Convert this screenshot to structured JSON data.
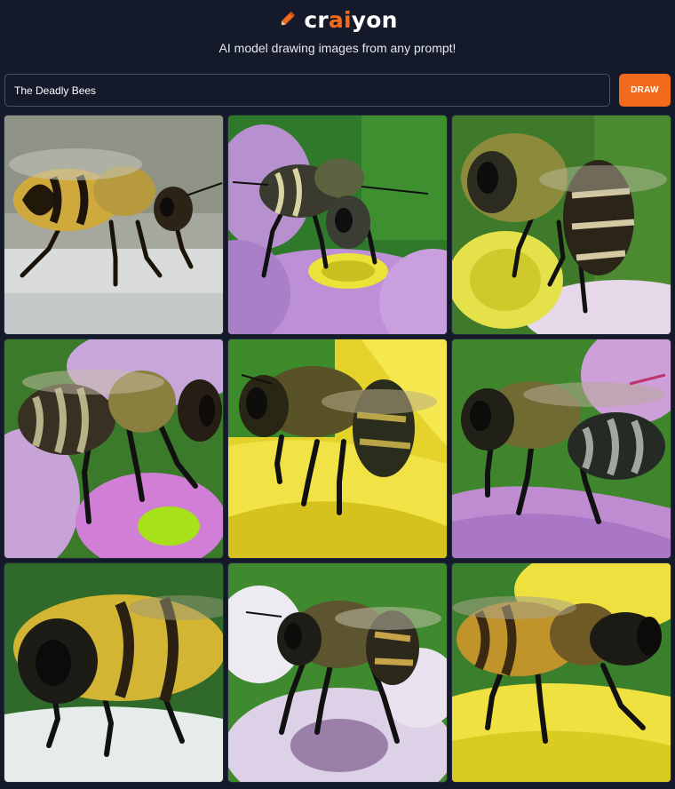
{
  "header": {
    "logo_part1": "cr",
    "logo_part2": "ai",
    "logo_part3": "yon",
    "subtitle": "AI model drawing images from any prompt!"
  },
  "prompt": {
    "value": "The Deadly Bees",
    "button_label": "DRAW"
  },
  "colors": {
    "background": "#141a2a",
    "accent": "#f26b1d",
    "text": "#ffffff"
  },
  "results": [
    {
      "subject": "bee on white surface"
    },
    {
      "subject": "bee on purple flower"
    },
    {
      "subject": "bee on yellow flower center"
    },
    {
      "subject": "bee on pink flower"
    },
    {
      "subject": "bee on yellow petals"
    },
    {
      "subject": "bee on purple petal"
    },
    {
      "subject": "bee on white surface close-up"
    },
    {
      "subject": "bee on white purple flower"
    },
    {
      "subject": "bee on yellow petal"
    }
  ]
}
